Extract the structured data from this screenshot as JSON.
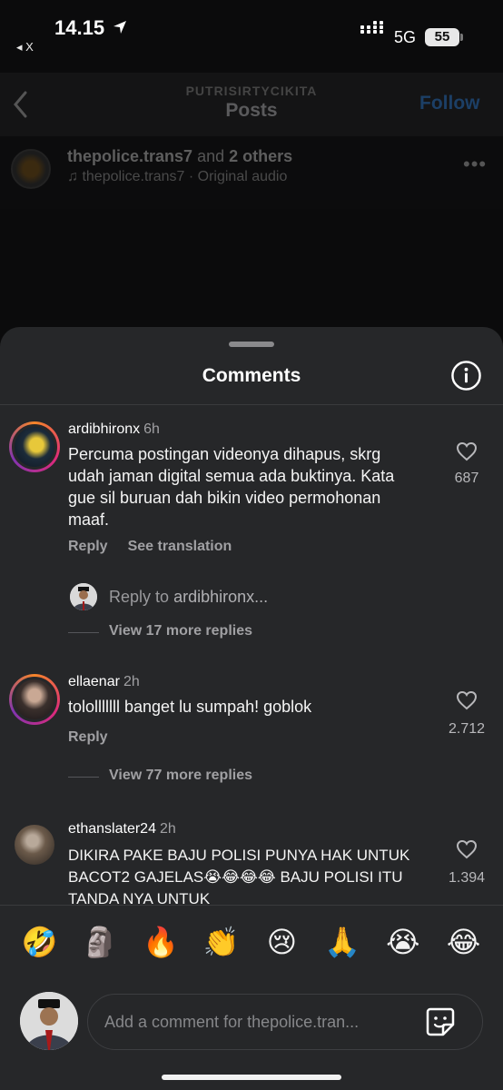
{
  "status_bar": {
    "time": "14.15",
    "back_app": "◂ X",
    "network": "5G",
    "battery": "55"
  },
  "header": {
    "account_name": "PUTRISIRTYCIKITA",
    "title": "Posts",
    "follow_label": "Follow"
  },
  "post": {
    "author": "thepolice.trans7",
    "and_text": "and",
    "others": "2 others",
    "audio": "thepolice.trans7 · Original audio"
  },
  "sheet": {
    "title": "Comments"
  },
  "comments": [
    {
      "username": "ardibhironx",
      "age": "6h",
      "text": "Percuma postingan videonya dihapus, skrg udah jaman digital semua ada buktinya. Kata gue sil buruan dah bikin video permohonan maaf.",
      "likes": "687",
      "reply_label": "Reply",
      "translate_label": "See translation",
      "reply_prompt_prefix": "Reply to",
      "reply_prompt_user": "ardibhironx...",
      "view_more": "View 17 more replies"
    },
    {
      "username": "ellaenar",
      "age": "2h",
      "text": "tololllllll banget lu sumpah! goblok",
      "likes": "2.712",
      "reply_label": "Reply",
      "view_more": "View 77 more replies"
    },
    {
      "username": "ethanslater24",
      "age": "2h",
      "text": "DIKIRA PAKE BAJU POLISI PUNYA HAK UNTUK BACOT2 GAJELAS😭😂😂😂 BAJU POLISI ITU TANDA NYA UNTUK",
      "likes": "1.394"
    }
  ],
  "emoji_bar": [
    "🤣",
    "🗿",
    "🔥",
    "👏",
    "😢",
    "🙏",
    "😭",
    "😂"
  ],
  "composer": {
    "placeholder": "Add a comment for thepolice.tran..."
  },
  "colors": {
    "sheet_bg": "#262729",
    "follow_dim": "#1c3f66",
    "muted_text": "#a0a0a3"
  }
}
